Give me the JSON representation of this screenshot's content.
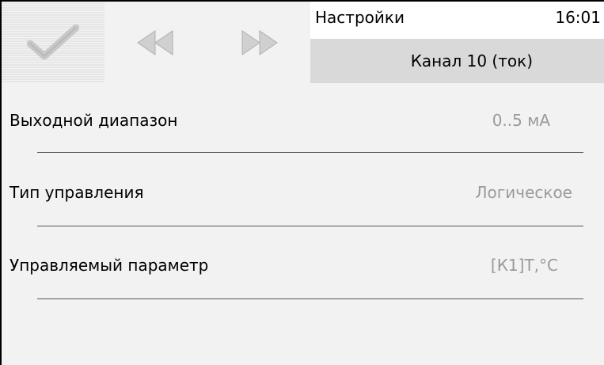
{
  "toolbar": {
    "confirm_icon": "checkmark-icon",
    "prev_icon": "rewind-icon",
    "next_icon": "fast-forward-icon"
  },
  "header": {
    "title": "Настройки",
    "time": "16:01",
    "subtitle": "Канал 10 (ток)"
  },
  "settings": [
    {
      "label": "Выходной диапазон",
      "value": "0..5 мА"
    },
    {
      "label": "Тип управления",
      "value": "Логическое"
    },
    {
      "label": "Управляемый параметр",
      "value": "[К1]Т,°C"
    }
  ],
  "colors": {
    "header_top_bg": "#ffffff",
    "header_bottom_bg": "#d9d9d9",
    "screen_bg": "#f2f2f2",
    "value_text": "#9a9a9a",
    "icon_gray": "#c8c8c8"
  }
}
